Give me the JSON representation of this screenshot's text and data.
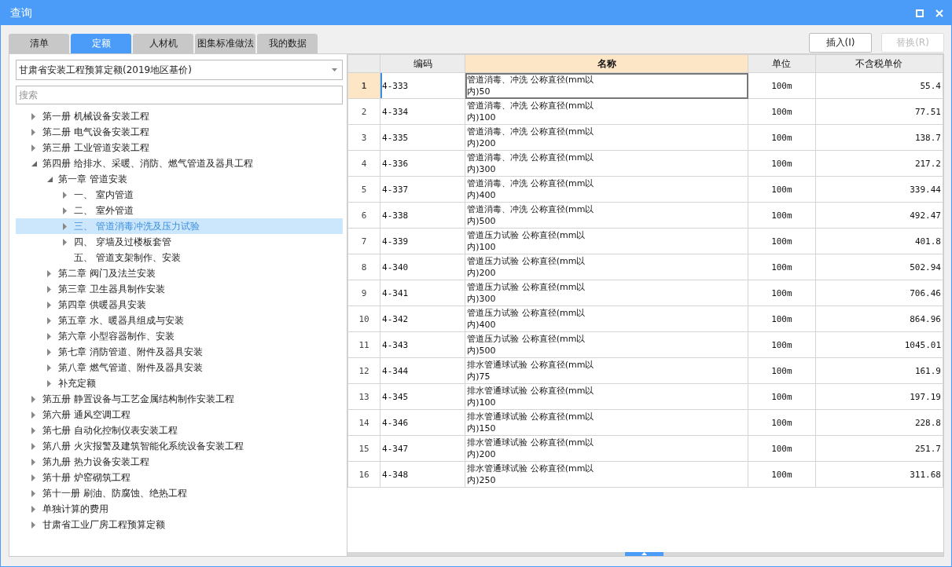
{
  "window": {
    "title": "查询"
  },
  "tabs": [
    {
      "label": "清单",
      "selected": false
    },
    {
      "label": "定额",
      "selected": true
    },
    {
      "label": "人材机",
      "selected": false
    },
    {
      "label": "图集标准做法",
      "selected": false
    },
    {
      "label": "我的数据",
      "selected": false
    }
  ],
  "buttons": [
    {
      "label": "插入(I)",
      "disabled": false
    },
    {
      "label": "替换(R)",
      "disabled": true
    }
  ],
  "library_select": {
    "value": "甘肃省安装工程预算定额(2019地区基价)"
  },
  "search": {
    "placeholder": "搜索"
  },
  "tree": [
    {
      "label": "第一册 机械设备安装工程",
      "kind": "folder",
      "expanded": false,
      "selected": false
    },
    {
      "label": "第二册 电气设备安装工程",
      "kind": "folder",
      "expanded": false,
      "selected": false
    },
    {
      "label": "第三册 工业管道安装工程",
      "kind": "folder",
      "expanded": false,
      "selected": false
    },
    {
      "label": "第四册 给排水、采暖、消防、燃气管道及器具工程",
      "kind": "folder",
      "expanded": true,
      "selected": false,
      "children": [
        {
          "label": "第一章 管道安装",
          "kind": "folder",
          "expanded": true,
          "selected": false,
          "children": [
            {
              "label": "一、  室内管道",
              "kind": "folder",
              "expanded": false,
              "selected": false
            },
            {
              "label": "二、  室外管道",
              "kind": "folder",
              "expanded": false,
              "selected": false
            },
            {
              "label": "三、  管道消毒冲洗及压力试验",
              "kind": "folder",
              "expanded": false,
              "selected": true
            },
            {
              "label": "四、  穿墙及过楼板套管",
              "kind": "folder",
              "expanded": false,
              "selected": false
            },
            {
              "label": "五、  管道支架制作、安装",
              "kind": "leaf",
              "expanded": false,
              "selected": false
            }
          ]
        },
        {
          "label": "第二章 阀门及法兰安装",
          "kind": "folder",
          "expanded": false,
          "selected": false
        },
        {
          "label": "第三章 卫生器具制作安装",
          "kind": "folder",
          "expanded": false,
          "selected": false
        },
        {
          "label": "第四章 供暖器具安装",
          "kind": "folder",
          "expanded": false,
          "selected": false
        },
        {
          "label": "第五章 水、暖器具组成与安装",
          "kind": "folder",
          "expanded": false,
          "selected": false
        },
        {
          "label": "第六章 小型容器制作、安装",
          "kind": "folder",
          "expanded": false,
          "selected": false
        },
        {
          "label": "第七章 消防管道、附件及器具安装",
          "kind": "folder",
          "expanded": false,
          "selected": false
        },
        {
          "label": "第八章 燃气管道、附件及器具安装",
          "kind": "folder",
          "expanded": false,
          "selected": false
        },
        {
          "label": "补充定额",
          "kind": "folder",
          "expanded": false,
          "selected": false
        }
      ]
    },
    {
      "label": "第五册 静置设备与工艺金属结构制作安装工程",
      "kind": "folder",
      "expanded": false,
      "selected": false
    },
    {
      "label": "第六册 通风空调工程",
      "kind": "folder",
      "expanded": false,
      "selected": false
    },
    {
      "label": "第七册 自动化控制仪表安装工程",
      "kind": "folder",
      "expanded": false,
      "selected": false
    },
    {
      "label": "第八册 火灾报警及建筑智能化系统设备安装工程",
      "kind": "folder",
      "expanded": false,
      "selected": false
    },
    {
      "label": "第九册 热力设备安装工程",
      "kind": "folder",
      "expanded": false,
      "selected": false
    },
    {
      "label": "第十册 炉窑砌筑工程",
      "kind": "folder",
      "expanded": false,
      "selected": false
    },
    {
      "label": "第十一册 刷油、防腐蚀、绝热工程",
      "kind": "folder",
      "expanded": false,
      "selected": false
    },
    {
      "label": "单独计算的费用",
      "kind": "folder",
      "expanded": false,
      "selected": false
    },
    {
      "label": "甘肃省工业厂房工程预算定额",
      "kind": "folder",
      "expanded": false,
      "selected": false
    }
  ],
  "table": {
    "columns": [
      {
        "label": "编码",
        "selected": false
      },
      {
        "label": "名称",
        "selected": true
      },
      {
        "label": "单位",
        "selected": false
      },
      {
        "label": "不含税单价",
        "selected": false
      }
    ],
    "rows": [
      {
        "no": "1",
        "code": "4-333",
        "name": "管道消毒、冲洗 公称直径(mm以内)50",
        "unit": "100m",
        "price": "55.4",
        "selected": true
      },
      {
        "no": "2",
        "code": "4-334",
        "name": "管道消毒、冲洗 公称直径(mm以内)100",
        "unit": "100m",
        "price": "77.51",
        "selected": false
      },
      {
        "no": "3",
        "code": "4-335",
        "name": "管道消毒、冲洗 公称直径(mm以内)200",
        "unit": "100m",
        "price": "138.7",
        "selected": false
      },
      {
        "no": "4",
        "code": "4-336",
        "name": "管道消毒、冲洗 公称直径(mm以内)300",
        "unit": "100m",
        "price": "217.2",
        "selected": false
      },
      {
        "no": "5",
        "code": "4-337",
        "name": "管道消毒、冲洗 公称直径(mm以内)400",
        "unit": "100m",
        "price": "339.44",
        "selected": false
      },
      {
        "no": "6",
        "code": "4-338",
        "name": "管道消毒、冲洗 公称直径(mm以内)500",
        "unit": "100m",
        "price": "492.47",
        "selected": false
      },
      {
        "no": "7",
        "code": "4-339",
        "name": "管道压力试验 公称直径(mm以内)100",
        "unit": "100m",
        "price": "401.8",
        "selected": false
      },
      {
        "no": "8",
        "code": "4-340",
        "name": "管道压力试验 公称直径(mm以内)200",
        "unit": "100m",
        "price": "502.94",
        "selected": false
      },
      {
        "no": "9",
        "code": "4-341",
        "name": "管道压力试验 公称直径(mm以内)300",
        "unit": "100m",
        "price": "706.46",
        "selected": false
      },
      {
        "no": "10",
        "code": "4-342",
        "name": "管道压力试验 公称直径(mm以内)400",
        "unit": "100m",
        "price": "864.96",
        "selected": false
      },
      {
        "no": "11",
        "code": "4-343",
        "name": "管道压力试验 公称直径(mm以内)500",
        "unit": "100m",
        "price": "1045.01",
        "selected": false
      },
      {
        "no": "12",
        "code": "4-344",
        "name": "排水管通球试验 公称直径(mm以内)75",
        "unit": "100m",
        "price": "161.9",
        "selected": false
      },
      {
        "no": "13",
        "code": "4-345",
        "name": "排水管通球试验 公称直径(mm以内)100",
        "unit": "100m",
        "price": "197.19",
        "selected": false
      },
      {
        "no": "14",
        "code": "4-346",
        "name": "排水管通球试验 公称直径(mm以内)150",
        "unit": "100m",
        "price": "228.8",
        "selected": false
      },
      {
        "no": "15",
        "code": "4-347",
        "name": "排水管通球试验 公称直径(mm以内)200",
        "unit": "100m",
        "price": "251.7",
        "selected": false
      },
      {
        "no": "16",
        "code": "4-348",
        "name": "排水管通球试验 公称直径(mm以内)250",
        "unit": "100m",
        "price": "311.68",
        "selected": false
      }
    ]
  }
}
